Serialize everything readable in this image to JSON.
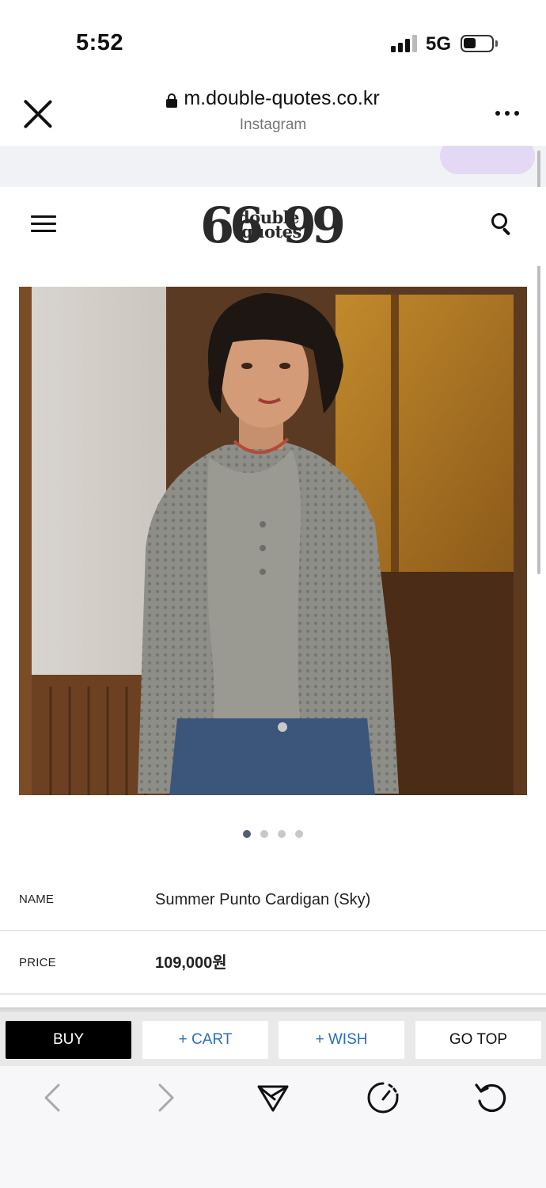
{
  "status_bar": {
    "time": "5:52",
    "network": "5G",
    "battery_level": 0.3
  },
  "browser": {
    "url": "m.double-quotes.co.kr",
    "source": "Instagram",
    "icons": [
      "close-icon",
      "lock-icon",
      "more-icon"
    ]
  },
  "site": {
    "logo_word_top": "double",
    "logo_word_bottom": "quotes",
    "icons": [
      "menu-icon",
      "search-icon"
    ]
  },
  "carousel": {
    "total_slides": 4,
    "active_slide": 1
  },
  "product": {
    "name_label": "NAME",
    "name_value": "Summer Punto Cardigan (Sky)",
    "price_label": "PRICE",
    "price_value": "109,000원"
  },
  "actions": {
    "buy": "BUY",
    "cart": "+ CART",
    "wish": "+ WISH",
    "top": "GO TOP"
  },
  "bottom_nav": {
    "icons": [
      "back-icon",
      "forward-icon",
      "share-icon",
      "speed-icon",
      "reload-icon"
    ]
  },
  "colors": {
    "accent_blue": "#2b6fb8",
    "buy_button": "#000000",
    "active_dot": "#545c74"
  }
}
